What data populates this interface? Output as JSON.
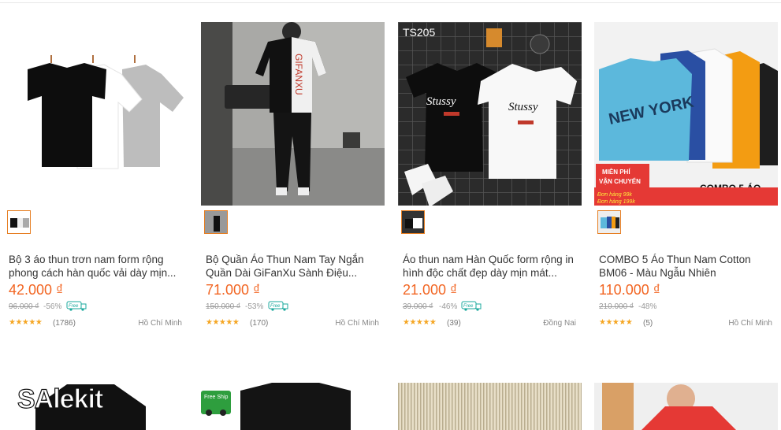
{
  "products": [
    {
      "title": "Bộ 3 áo thun trơn nam form rộng phong cách hàn quốc vải dày mịn...",
      "price": "42.000 ₫",
      "old_price": "96.000 ₫",
      "discount": "-56%",
      "free_ship": "Free",
      "rating_count": "(1786)",
      "location": "Hồ Chí Minh",
      "stars": "★★★★★"
    },
    {
      "title": "Bộ Quần Áo Thun Nam Tay Ngắn Quần Dài GiFanXu Sành Điệu...",
      "price": "71.000 ₫",
      "old_price": "150.000 ₫",
      "discount": "-53%",
      "free_ship": "Free",
      "rating_count": "(170)",
      "location": "Hồ Chí Minh",
      "stars": "★★★★★"
    },
    {
      "title": "Áo thun nam Hàn Quốc form rộng in hình độc chất đẹp dày mịn mát...",
      "price": "21.000 ₫",
      "old_price": "39.000 ₫",
      "discount": "-46%",
      "free_ship": "Free",
      "rating_count": "(39)",
      "location": "Đồng Nai",
      "stars": "★★★★★"
    },
    {
      "title": "COMBO 5 Áo Thun Nam Cotton BM06 - Màu Ngẫu Nhiên",
      "price": "110.000 ₫",
      "old_price": "210.000 ₫",
      "discount": "-48%",
      "free_ship": "",
      "rating_count": "(5)",
      "location": "Hồ Chí Minh",
      "stars": "★★★★★"
    }
  ],
  "image_texts": {
    "ts_label": "TS205",
    "brand_a": "Stussy",
    "gifanxu": "GIFANXU",
    "new_york": "NEW YORK",
    "combo_label": "COMBO 5 ÁO",
    "promo_line1": "MIỄN PHÍ",
    "promo_line2": "VẬN CHUYỂN",
    "promo_order1": "Đơn hàng 99k",
    "promo_order2": "Đơn hàng 199k",
    "free_ship_badge": "Free Ship"
  },
  "watermark": "SAlekit",
  "colors": {
    "accent": "#f26522",
    "star": "#f5a623",
    "free": "#1aa89c"
  }
}
